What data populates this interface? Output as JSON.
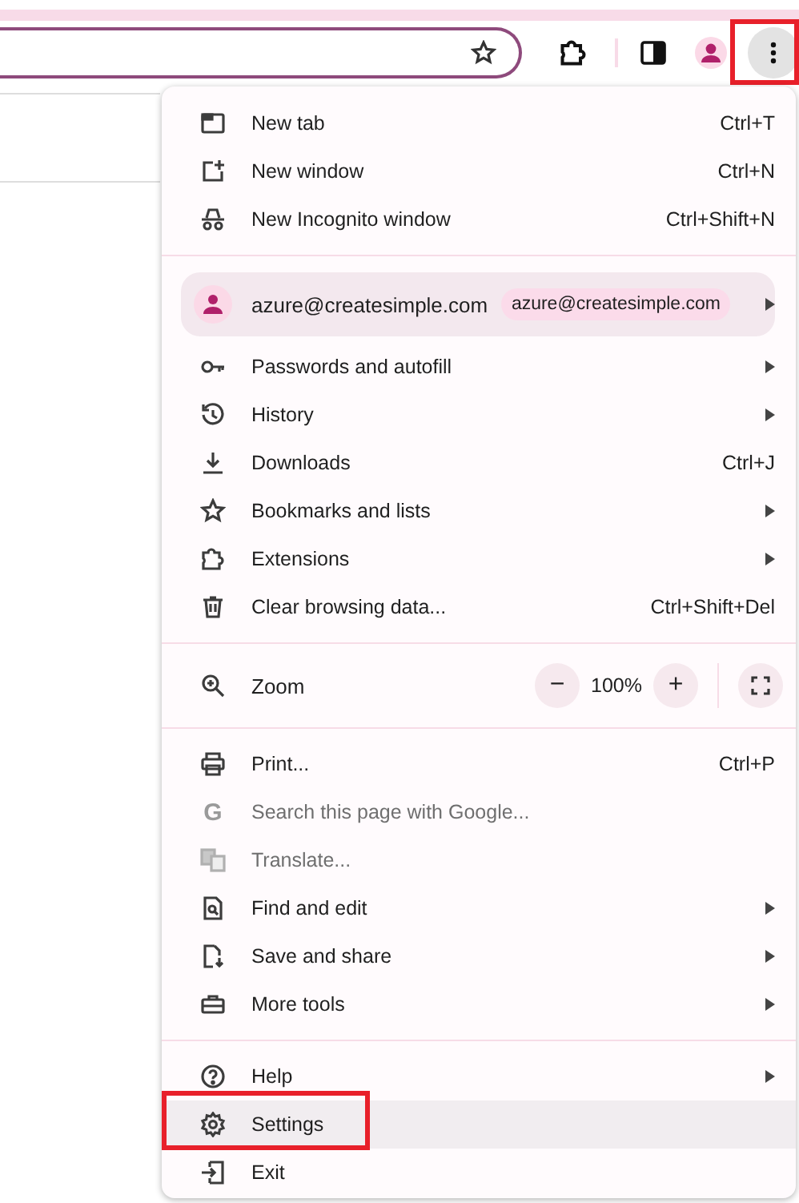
{
  "toolbar": {
    "menu_button_outlined": true
  },
  "menu": {
    "sections": [
      {
        "items": [
          {
            "kind": "item",
            "label": "New tab",
            "shortcut": "Ctrl+T",
            "submenu": false,
            "disabled": false,
            "selected": false,
            "outlined": false
          },
          {
            "kind": "item",
            "label": "New window",
            "shortcut": "Ctrl+N",
            "submenu": false,
            "disabled": false,
            "selected": false,
            "outlined": false
          },
          {
            "kind": "item",
            "label": "New Incognito window",
            "shortcut": "Ctrl+Shift+N",
            "submenu": false,
            "disabled": false,
            "selected": false,
            "outlined": false
          }
        ]
      },
      {
        "items": [
          {
            "kind": "profile",
            "label": "azure@createsimple.com",
            "chip": "azure@createsimple.com",
            "submenu": true
          },
          {
            "kind": "item",
            "label": "Passwords and autofill",
            "submenu": true,
            "disabled": false,
            "selected": false,
            "outlined": false
          },
          {
            "kind": "item",
            "label": "History",
            "submenu": true,
            "disabled": false,
            "selected": false,
            "outlined": false
          },
          {
            "kind": "item",
            "label": "Downloads",
            "shortcut": "Ctrl+J",
            "submenu": false,
            "disabled": false,
            "selected": false,
            "outlined": false
          },
          {
            "kind": "item",
            "label": "Bookmarks and lists",
            "submenu": true,
            "disabled": false,
            "selected": false,
            "outlined": false
          },
          {
            "kind": "item",
            "label": "Extensions",
            "submenu": true,
            "disabled": false,
            "selected": false,
            "outlined": false
          },
          {
            "kind": "item",
            "label": "Clear browsing data...",
            "shortcut": "Ctrl+Shift+Del",
            "submenu": false,
            "disabled": false,
            "selected": false,
            "outlined": false
          }
        ]
      },
      {
        "items": [
          {
            "kind": "zoom",
            "label": "Zoom",
            "minus": "−",
            "value": "100%",
            "plus": "+"
          }
        ]
      },
      {
        "items": [
          {
            "kind": "item",
            "label": "Print...",
            "shortcut": "Ctrl+P",
            "submenu": false,
            "disabled": false,
            "selected": false,
            "outlined": false
          },
          {
            "kind": "item",
            "label": "Search this page with Google...",
            "icon_char": "G",
            "submenu": false,
            "disabled": true,
            "selected": false,
            "outlined": false
          },
          {
            "kind": "item",
            "label": "Translate...",
            "submenu": false,
            "disabled": true,
            "selected": false,
            "outlined": false
          },
          {
            "kind": "item",
            "label": "Find and edit",
            "submenu": true,
            "disabled": false,
            "selected": false,
            "outlined": false
          },
          {
            "kind": "item",
            "label": "Save and share",
            "submenu": true,
            "disabled": false,
            "selected": false,
            "outlined": false
          },
          {
            "kind": "item",
            "label": "More tools",
            "submenu": true,
            "disabled": false,
            "selected": false,
            "outlined": false
          }
        ]
      },
      {
        "items": [
          {
            "kind": "item",
            "label": "Help",
            "submenu": true,
            "disabled": false,
            "selected": false,
            "outlined": false
          },
          {
            "kind": "item",
            "label": "Settings",
            "submenu": false,
            "disabled": false,
            "selected": true,
            "outlined": true
          },
          {
            "kind": "item",
            "label": "Exit",
            "submenu": false,
            "disabled": false,
            "selected": false,
            "outlined": false
          }
        ]
      }
    ]
  }
}
